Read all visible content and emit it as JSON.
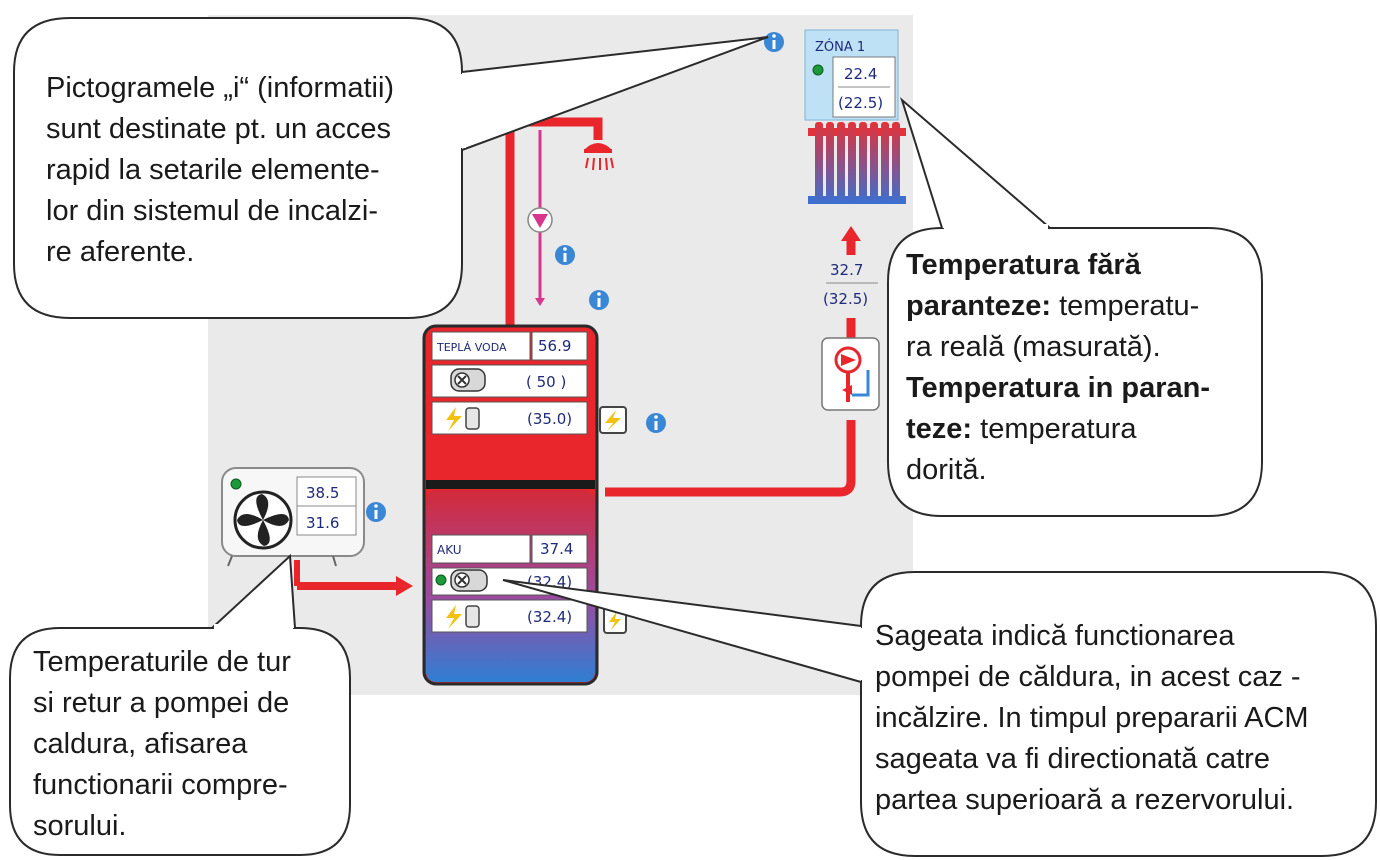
{
  "zone": {
    "title": "ZÓNA 1",
    "actual": "22.4",
    "desired": "(22.5)"
  },
  "radiator_flow": {
    "actual": "32.7",
    "desired": "(32.5)"
  },
  "tank_top": {
    "label": "TEPLÁ VODA",
    "temp": "56.9",
    "row2_value": "( 50 )",
    "row3_value": "(35.0)"
  },
  "tank_bottom": {
    "label": "AKU",
    "temp": "37.4",
    "row2_value": "(32.4)",
    "row3_value": "(32.4)"
  },
  "heat_pump": {
    "supply": "38.5",
    "return": "31.6"
  },
  "callouts": {
    "info_icons": [
      "Pictogramele „i“ (informatii)",
      "sunt destinate pt. un acces",
      "rapid la setarile elemente-",
      "lor din sistemul de  incalzi-",
      "re aferente."
    ],
    "temperature": {
      "bold1": "Temperatura fără",
      "bold2": "paranteze:",
      "rest2": " temperatu-",
      "line3": "ra reală (masurată).",
      "bold4": "Temperatura in paran-",
      "bold5": "teze:",
      "rest5": " temperatura",
      "line6": "dorită."
    },
    "heat_pump": [
      "Temperaturile de tur",
      "si retur a pompei de",
      "caldura, afisarea",
      "functionarii compre-",
      "sorului."
    ],
    "arrow": [
      "Sageata  indică functionarea",
      "pompei de căldura, in acest caz -",
      "incălzire. In timpul prepararii ACM",
      "sageata va fi directionată catre",
      "partea superioară a rezervorului."
    ]
  },
  "colors": {
    "pipe_red": "#e8262b",
    "pipe_pink": "#d6368c",
    "info_blue": "#3a87d6",
    "panel_gray": "#eaeaea",
    "zone_blue": "#bfe1f5"
  }
}
